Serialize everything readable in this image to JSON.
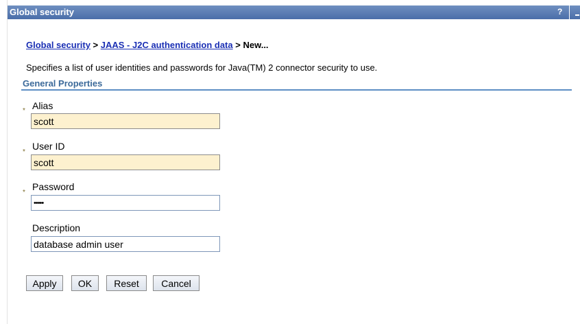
{
  "window": {
    "title": "Global security",
    "help_label": "?"
  },
  "breadcrumb": {
    "link1": "Global security",
    "sep1": " > ",
    "link2": "JAAS - J2C authentication data",
    "sep2": " > ",
    "current": "New..."
  },
  "description": "Specifies a list of user identities and passwords for Java(TM) 2 connector security to use.",
  "section": {
    "title": "General Properties"
  },
  "required_marker": "*",
  "fields": {
    "alias": {
      "label": "Alias",
      "value": "scott",
      "required": true
    },
    "user_id": {
      "label": "User ID",
      "value": "scott",
      "required": true
    },
    "password": {
      "label": "Password",
      "value": "•••••",
      "required": true
    },
    "description": {
      "label": "Description",
      "value": "database admin user",
      "required": false
    }
  },
  "buttons": {
    "apply": "Apply",
    "ok": "OK",
    "reset": "Reset",
    "cancel": "Cancel"
  },
  "colors": {
    "titlebar": "#4a6ea9",
    "link": "#1a2fb4",
    "section_header": "#3c6a9a",
    "required_field_bg": "#fdf1cf"
  }
}
